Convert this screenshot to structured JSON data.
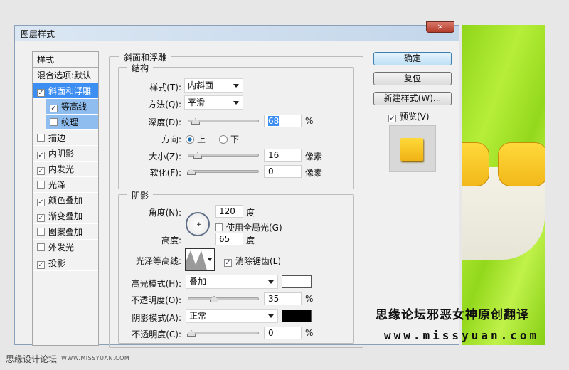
{
  "dialog": {
    "title": "图层样式",
    "close_icon": "×"
  },
  "style_list": {
    "header": "样式",
    "blend": "混合选项:默认",
    "items": [
      {
        "label": "斜面和浮雕",
        "checked": true
      },
      {
        "label": "等高线",
        "checked": true
      },
      {
        "label": "纹理",
        "checked": false
      },
      {
        "label": "描边",
        "checked": false
      },
      {
        "label": "内阴影",
        "checked": true
      },
      {
        "label": "内发光",
        "checked": true
      },
      {
        "label": "光泽",
        "checked": false
      },
      {
        "label": "颜色叠加",
        "checked": true
      },
      {
        "label": "渐变叠加",
        "checked": true
      },
      {
        "label": "图案叠加",
        "checked": false
      },
      {
        "label": "外发光",
        "checked": false
      },
      {
        "label": "投影",
        "checked": true
      }
    ]
  },
  "bevel": {
    "legend": "斜面和浮雕",
    "structure": {
      "legend": "结构",
      "style_label": "样式(T):",
      "style_value": "内斜面",
      "technique_label": "方法(Q):",
      "technique_value": "平滑",
      "depth_label": "深度(D):",
      "depth_value": "68",
      "depth_unit": "%",
      "depth_fraction": 0.068,
      "direction_label": "方向:",
      "up": "上",
      "down": "下",
      "size_label": "大小(Z):",
      "size_value": "16",
      "size_unit": "像素",
      "size_fraction": 0.065,
      "soften_label": "软化(F):",
      "soften_value": "0",
      "soften_unit": "像素"
    },
    "shading": {
      "legend": "阴影",
      "angle_label": "角度(N):",
      "angle_value": "120",
      "angle_unit": "度",
      "global_light": "使用全局光(G)",
      "altitude_label": "高度:",
      "altitude_value": "65",
      "altitude_unit": "度",
      "gloss_label": "光泽等高线:",
      "antialias": "消除锯齿(L)",
      "highlight_label": "高光模式(H):",
      "highlight_value": "叠加",
      "highlight_color": "#ffffff",
      "hl_opacity_label": "不透明度(O):",
      "hl_opacity_value": "35",
      "shadow_label": "阴影模式(A):",
      "shadow_value": "正常",
      "shadow_color": "#000000",
      "sh_opacity_label": "不透明度(C):",
      "sh_opacity_value": "0",
      "pct": "%"
    }
  },
  "buttons": {
    "ok": "确定",
    "reset": "复位",
    "new_style": "新建样式(W)...",
    "preview": "预览(V)"
  },
  "watermark": {
    "line1": "思缘论坛邪恶女神原创翻译",
    "line2": "www.missyuan.com"
  },
  "footer": {
    "site": "思缘设计论坛",
    "url": "WWW.MISSYUAN.COM"
  }
}
